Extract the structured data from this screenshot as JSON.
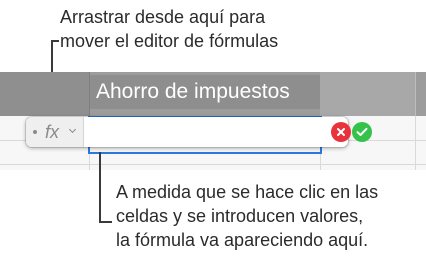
{
  "callouts": {
    "drag": {
      "line1": "Arrastrar desde aquí para",
      "line2": "mover el editor de fórmulas"
    },
    "formula": {
      "line1": "A medida que se hace clic en las",
      "line2": "celdas y se introducen valores,",
      "line3": "la fórmula va apareciendo aquí."
    }
  },
  "sheet": {
    "header_cell": "Ahorro de impuestos"
  },
  "formula_editor": {
    "fx_label": "fx",
    "value": "",
    "icons": {
      "drag": "drag-handle-icon",
      "menu": "chevron-down-icon",
      "cancel": "cancel-x-icon",
      "accept": "checkmark-icon"
    }
  },
  "colors": {
    "header_band": "#9c9c9c",
    "selection": "#2b79e0",
    "cancel": "#e8333d",
    "accept": "#35c24a"
  }
}
